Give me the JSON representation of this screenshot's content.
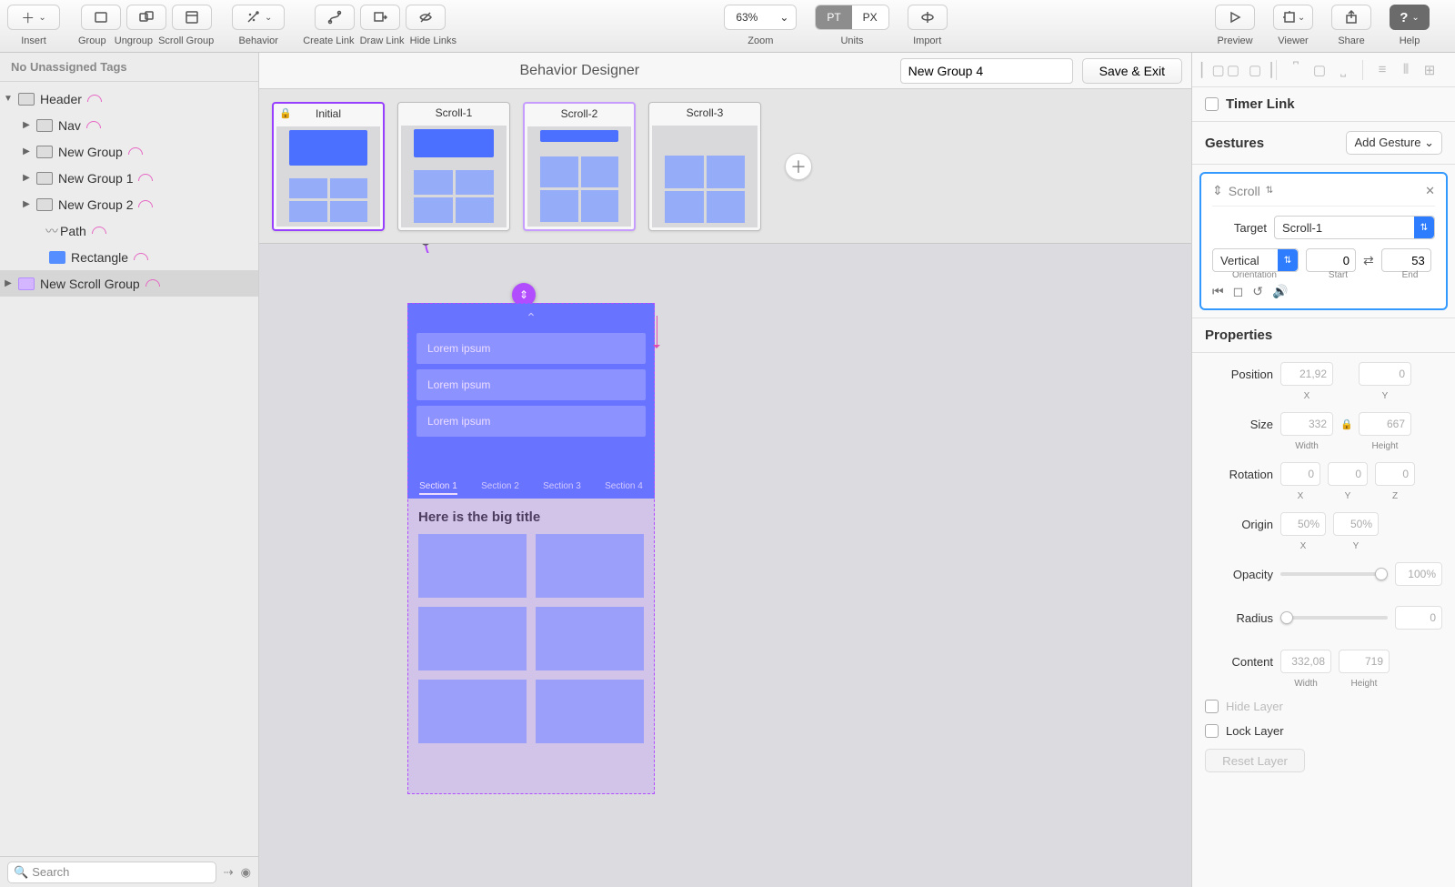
{
  "toolbar": {
    "insert": "Insert",
    "group": "Group",
    "ungroup": "Ungroup",
    "scroll_group": "Scroll Group",
    "behavior": "Behavior",
    "create_link": "Create Link",
    "draw_link": "Draw Link",
    "hide_links": "Hide Links",
    "zoom_label": "Zoom",
    "zoom_value": "63%",
    "units_label": "Units",
    "unit_pt": "PT",
    "unit_px": "PX",
    "import": "Import",
    "preview": "Preview",
    "viewer": "Viewer",
    "share": "Share",
    "help": "Help"
  },
  "sidebar": {
    "no_tags": "No Unassigned Tags",
    "items": [
      "Header",
      "Nav",
      "New Group",
      "New Group 1",
      "New Group 2",
      "Path",
      "Rectangle",
      "New Scroll Group"
    ],
    "search_placeholder": "Search"
  },
  "center": {
    "title": "Behavior Designer",
    "group_name": "New Group 4",
    "save": "Save & Exit",
    "scenes": [
      "Initial",
      "Scroll-1",
      "Scroll-2",
      "Scroll-3"
    ]
  },
  "mockup": {
    "list": [
      "Lorem ipsum",
      "Lorem ipsum",
      "Lorem ipsum"
    ],
    "tabs": [
      "Section 1",
      "Section 2",
      "Section 3",
      "Section 4"
    ],
    "title": "Here is the big title"
  },
  "right": {
    "timer_link": "Timer Link",
    "gestures": "Gestures",
    "add_gesture": "Add Gesture",
    "scroll": "Scroll",
    "target_label": "Target",
    "target_value": "Scroll-1",
    "orientation_value": "Vertical",
    "orientation_label": "Orientation",
    "start_label": "Start",
    "end_label": "End",
    "start": "0",
    "end": "53",
    "properties": "Properties",
    "position": "Position",
    "pos_x": "21,92",
    "pos_y": "0",
    "size": "Size",
    "w": "332",
    "h": "667",
    "rotation": "Rotation",
    "rx": "0",
    "ry": "0",
    "rz": "0",
    "origin": "Origin",
    "ox": "50%",
    "oy": "50%",
    "opacity": "Opacity",
    "opacity_v": "100%",
    "radius": "Radius",
    "radius_v": "0",
    "content": "Content",
    "cw": "332,08",
    "ch": "719",
    "hide_layer": "Hide Layer",
    "lock_layer": "Lock Layer",
    "reset": "Reset Layer",
    "x": "X",
    "y": "Y",
    "z": "Z",
    "width": "Width",
    "height": "Height"
  }
}
